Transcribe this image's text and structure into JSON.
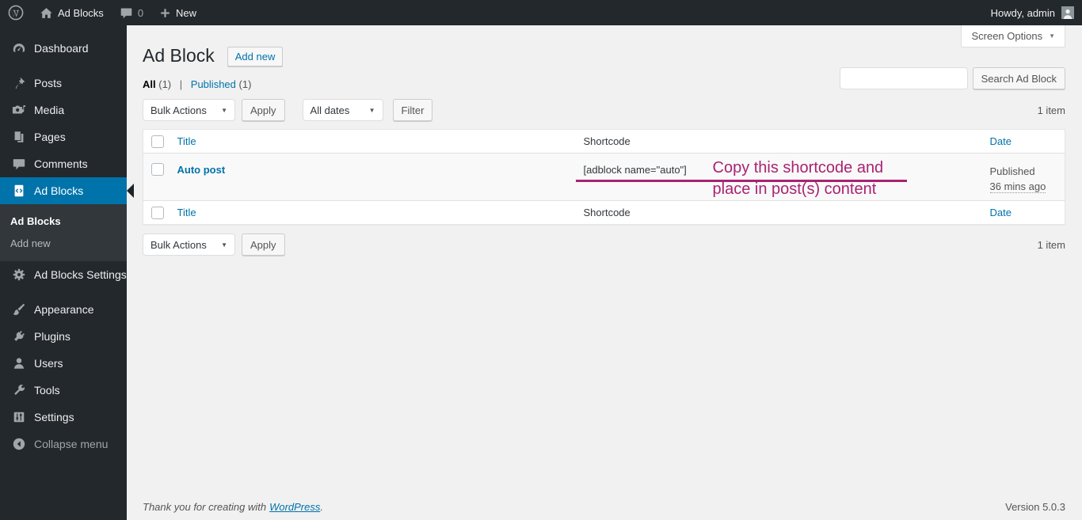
{
  "admin_bar": {
    "site_name": "Ad Blocks",
    "comment_count": "0",
    "new_label": "New",
    "howdy": "Howdy, admin"
  },
  "sidebar": {
    "items": [
      {
        "label": "Dashboard"
      },
      {
        "label": "Posts"
      },
      {
        "label": "Media"
      },
      {
        "label": "Pages"
      },
      {
        "label": "Comments"
      },
      {
        "label": "Ad Blocks"
      },
      {
        "label": "Ad Blocks Settings"
      },
      {
        "label": "Appearance"
      },
      {
        "label": "Plugins"
      },
      {
        "label": "Users"
      },
      {
        "label": "Tools"
      },
      {
        "label": "Settings"
      },
      {
        "label": "Collapse menu"
      }
    ],
    "submenu": [
      {
        "label": "Ad Blocks"
      },
      {
        "label": "Add new"
      }
    ]
  },
  "header": {
    "title": "Ad Block",
    "add_new_label": "Add new",
    "screen_options_label": "Screen Options"
  },
  "filters": {
    "all_label": "All",
    "all_count": "(1)",
    "separator": "|",
    "published_label": "Published",
    "published_count": "(1)",
    "bulk_actions": "Bulk Actions",
    "apply_label": "Apply",
    "all_dates": "All dates",
    "filter_label": "Filter",
    "search_button": "Search Ad Block",
    "item_count": "1 item"
  },
  "table": {
    "columns": {
      "title": "Title",
      "shortcode": "Shortcode",
      "date": "Date"
    },
    "rows": [
      {
        "title": "Auto post",
        "shortcode": "[adblock name=\"auto\"]",
        "date_status": "Published",
        "date_time": "36 mins ago"
      }
    ]
  },
  "annotation": {
    "line1": "Copy this shortcode and",
    "line2": "place in post(s) content",
    "color": "#a92371"
  },
  "footer": {
    "thanks_prefix": "Thank you for creating with",
    "wordpress_link": "WordPress",
    "thanks_suffix": ".",
    "version": "Version 5.0.3"
  },
  "colors": {
    "accent_blue": "#0073aa",
    "admin_bar_bg": "#23282d",
    "submenu_bg": "#32373c",
    "content_bg": "#f1f1f1",
    "annotation": "#a92371"
  }
}
